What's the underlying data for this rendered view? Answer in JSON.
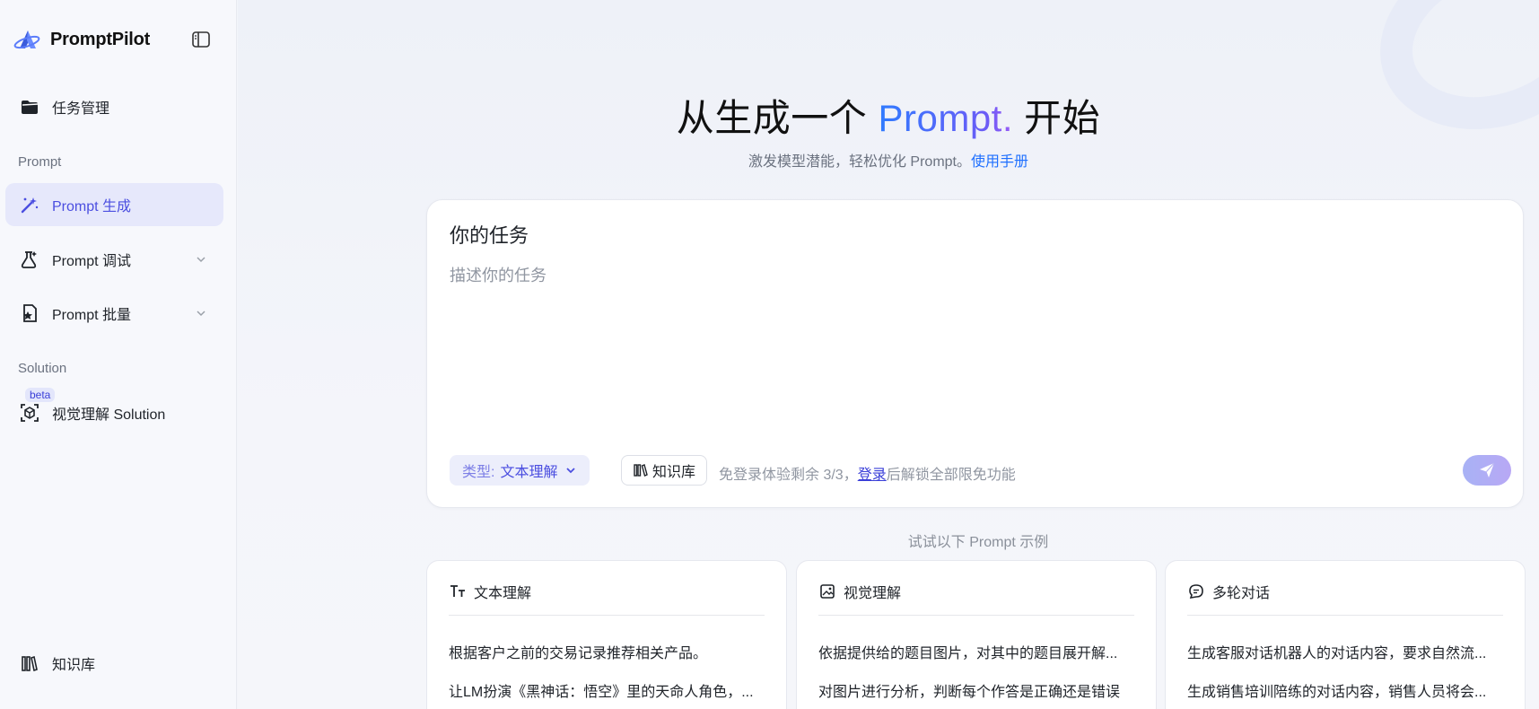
{
  "brand": {
    "name": "PromptPilot"
  },
  "sidebar": {
    "task_management": "任务管理",
    "section_prompt": "Prompt",
    "items": [
      {
        "label": "Prompt 生成"
      },
      {
        "label": "Prompt 调试"
      },
      {
        "label": "Prompt 批量"
      }
    ],
    "section_solution": "Solution",
    "beta": "beta",
    "visual_solution": "视觉理解 Solution",
    "knowledge_base": "知识库"
  },
  "hero": {
    "title_pre": "从生成一个 ",
    "title_accent": "Prompt.",
    "title_post": " 开始",
    "subtitle": "激发模型潜能，轻松优化 Prompt。",
    "manual_link": "使用手册"
  },
  "task": {
    "title": "你的任务",
    "placeholder": "描述你的任务",
    "type_label": "类型:",
    "type_value": "文本理解",
    "kb_button": "知识库",
    "trial_pre": "免登录体验剩余 3/3，",
    "login_link": "登录",
    "trial_post": "后解锁全部限免功能"
  },
  "examples": {
    "label": "试试以下 Prompt 示例",
    "cards": [
      {
        "title": "文本理解",
        "lines": [
          "根据客户之前的交易记录推荐相关产品。",
          "让LM扮演《黑神话：悟空》里的天命人角色，..."
        ]
      },
      {
        "title": "视觉理解",
        "lines": [
          "依据提供给的题目图片，对其中的题目展开解...",
          "对图片进行分析，判断每个作答是正确还是错误"
        ]
      },
      {
        "title": "多轮对话",
        "lines": [
          "生成客服对话机器人的对话内容，要求自然流...",
          "生成销售培训陪练的对话内容，销售人员将会..."
        ]
      }
    ]
  },
  "colors": {
    "accent": "#4b4ee0",
    "link": "#1e6fff",
    "active_bg": "#e6e8fb"
  }
}
